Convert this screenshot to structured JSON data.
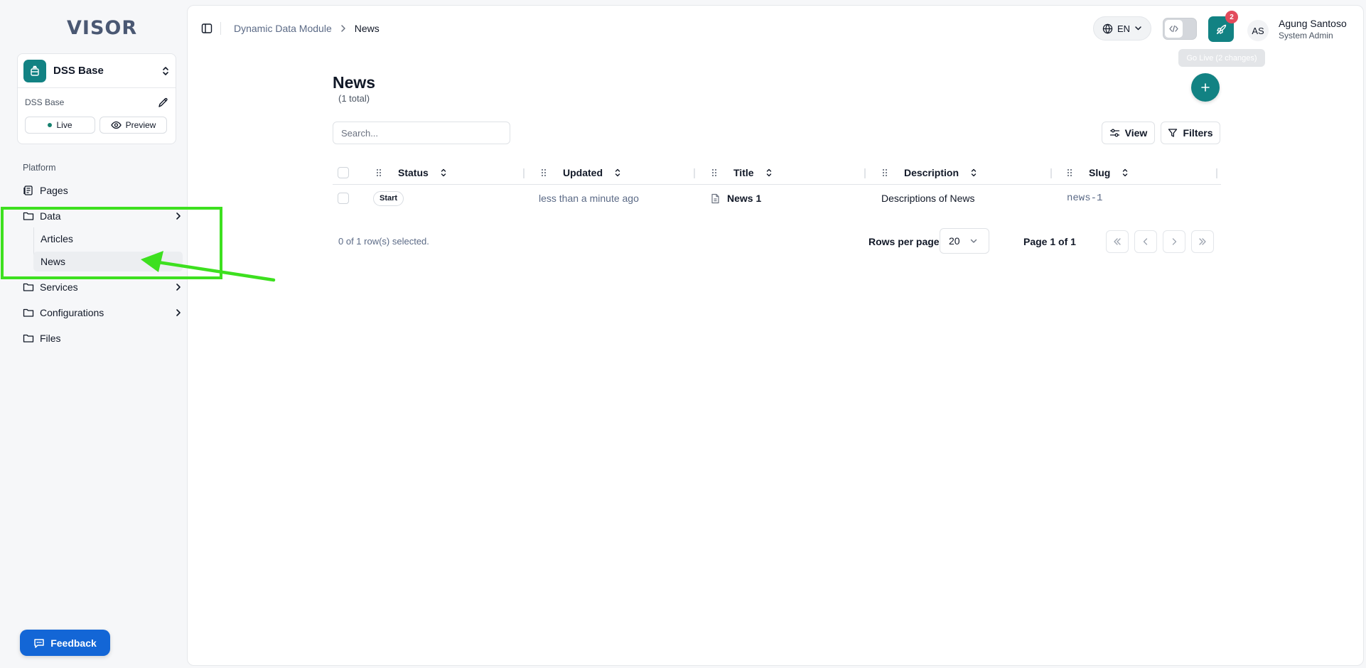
{
  "app": {
    "logo": "VISOR"
  },
  "site": {
    "name": "DSS Base",
    "subtitle": "DSS Base",
    "live_label": "Live",
    "preview_label": "Preview"
  },
  "sidebar": {
    "section_label": "Platform",
    "items": [
      {
        "label": "Pages",
        "icon": "pages-icon"
      },
      {
        "label": "Data",
        "icon": "folder-icon",
        "expanded": true,
        "children": [
          {
            "label": "Articles"
          },
          {
            "label": "News",
            "active": true
          }
        ]
      },
      {
        "label": "Services",
        "icon": "folder-icon"
      },
      {
        "label": "Configurations",
        "icon": "folder-icon"
      },
      {
        "label": "Files",
        "icon": "folder-icon"
      }
    ],
    "feedback_label": "Feedback"
  },
  "topbar": {
    "breadcrumb": [
      "Dynamic Data Module",
      "News"
    ],
    "language": "EN",
    "go_live_badge": "2",
    "go_live_tooltip": "Go Live (2 changes)",
    "user": {
      "initials": "AS",
      "name": "Agung Santoso",
      "role": "System Admin"
    }
  },
  "page": {
    "title": "News",
    "count": "(1 total)",
    "search_placeholder": "Search...",
    "view_label": "View",
    "filters_label": "Filters"
  },
  "table": {
    "columns": [
      "Status",
      "Updated",
      "Title",
      "Description",
      "Slug"
    ],
    "rows": [
      {
        "status": "Start",
        "updated": "less than a minute ago",
        "title": "News 1",
        "description": "Descriptions of News",
        "slug": "news-1"
      }
    ]
  },
  "pagination": {
    "selected_info": "0 of 1 row(s) selected.",
    "rows_per_page_label": "Rows per page",
    "rows_per_page": "20",
    "page_info": "Page 1 of 1"
  },
  "colors": {
    "accent": "#128283",
    "annotation": "#3de01f",
    "badge": "#e24b5c",
    "feedback": "#1366d6"
  }
}
